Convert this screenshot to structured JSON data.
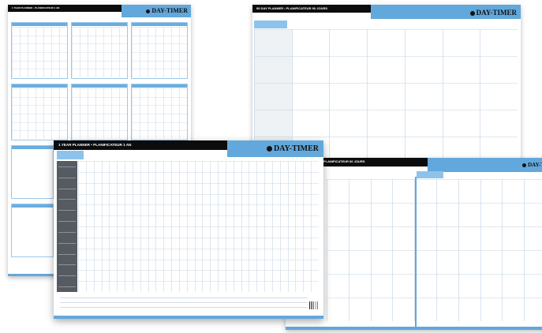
{
  "planners": {
    "year_topleft": {
      "title": "1 YEAR PLANNER • PLANIFICATEUR 1 AN",
      "brand": "DAY-TIMER"
    },
    "days90": {
      "title": "90 DAY PLANNER • PLANIFICATEUR 90 JOURS",
      "brand": "DAY-TIMER"
    },
    "year_front": {
      "title": "1 YEAR PLANNER • PLANIFICATEUR 1 AN",
      "brand": "DAY-TIMER"
    },
    "days60": {
      "title": "PLANIFICATEUR 60 JOURS",
      "brand": "DAY-T"
    }
  },
  "colors": {
    "accent": "#62a8dc",
    "header": "#0c0c0c",
    "sidebar": "#555b61",
    "grid": "#bfd3e4"
  }
}
